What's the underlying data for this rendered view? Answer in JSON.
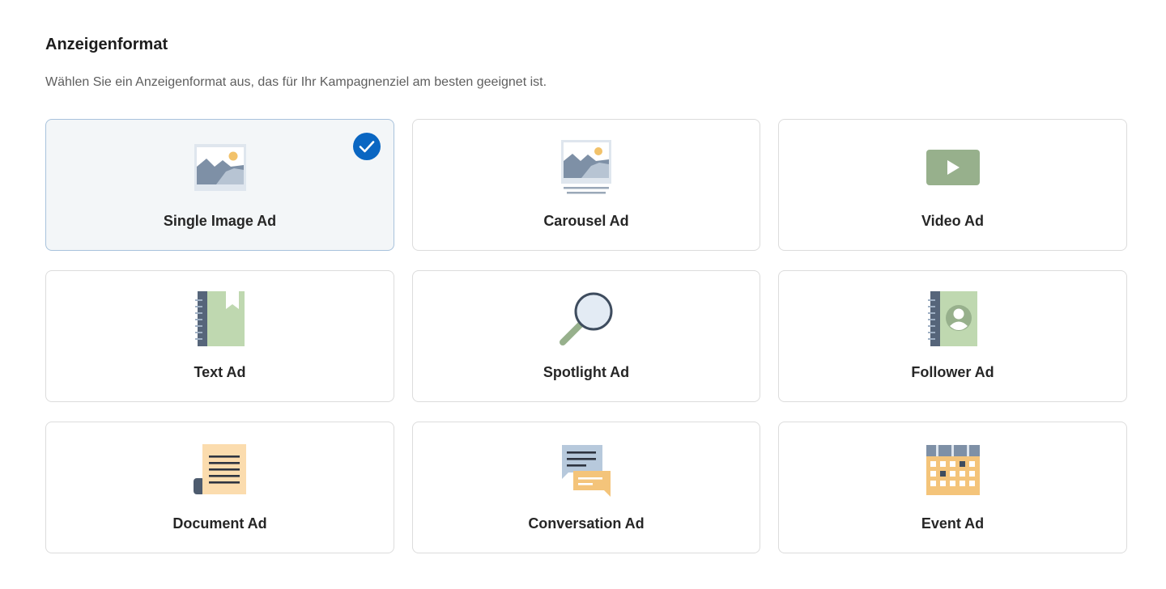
{
  "section": {
    "title": "Anzeigenformat",
    "description": "Wählen Sie ein Anzeigenformat aus, das für Ihr Kampagnenziel am besten geeignet ist."
  },
  "formats": [
    {
      "label": "Single Image Ad",
      "icon": "single-image-icon",
      "selected": true
    },
    {
      "label": "Carousel Ad",
      "icon": "carousel-icon",
      "selected": false
    },
    {
      "label": "Video Ad",
      "icon": "video-icon",
      "selected": false
    },
    {
      "label": "Text Ad",
      "icon": "text-notebook-icon",
      "selected": false
    },
    {
      "label": "Spotlight Ad",
      "icon": "magnifier-icon",
      "selected": false
    },
    {
      "label": "Follower Ad",
      "icon": "contact-book-icon",
      "selected": false
    },
    {
      "label": "Document Ad",
      "icon": "document-scroll-icon",
      "selected": false
    },
    {
      "label": "Conversation Ad",
      "icon": "chat-bubbles-icon",
      "selected": false
    },
    {
      "label": "Event Ad",
      "icon": "calendar-icon",
      "selected": false
    }
  ],
  "colors": {
    "selected_check": "#0a66c2",
    "selected_bg": "#f3f6f8",
    "selected_border": "#a8c2dc",
    "card_border": "#dcdcdc"
  }
}
